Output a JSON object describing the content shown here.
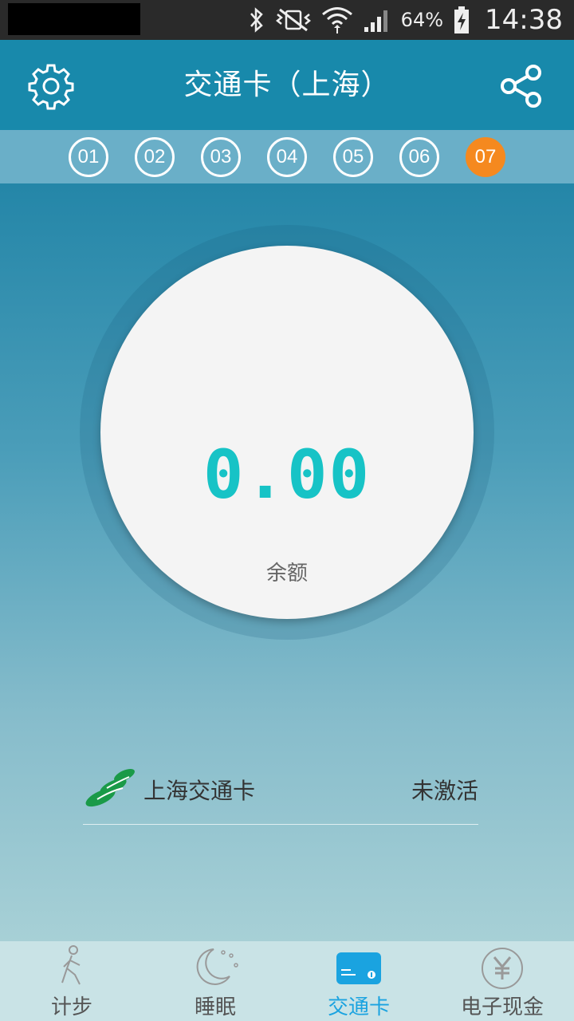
{
  "status_bar": {
    "battery_percent": "64%",
    "time": "14:38"
  },
  "header": {
    "title": "交通卡（上海）"
  },
  "card_tabs": [
    "01",
    "02",
    "03",
    "04",
    "05",
    "06",
    "07"
  ],
  "card_tabs_active_index": 6,
  "balance": {
    "amount": "0.00",
    "label": "余额"
  },
  "card": {
    "name": "上海交通卡",
    "status": "未激活"
  },
  "nav": {
    "items": [
      {
        "label": "计步",
        "icon": "walk-icon"
      },
      {
        "label": "睡眠",
        "icon": "moon-icon"
      },
      {
        "label": "交通卡",
        "icon": "card-icon"
      },
      {
        "label": "电子现金",
        "icon": "yen-icon"
      }
    ],
    "active_index": 2
  },
  "colors": {
    "header": "#1889ab",
    "accent": "#17c3c6",
    "active_tab": "#f5891f",
    "nav_active": "#1aa3e0"
  }
}
